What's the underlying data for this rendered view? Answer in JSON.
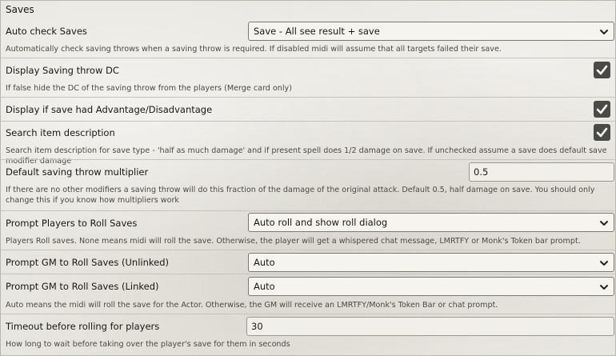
{
  "section": {
    "title": "Saves"
  },
  "settings": [
    {
      "label": "Auto check Saves",
      "control": "select",
      "value": "Save - All see result + save",
      "hint": "Automatically check saving throws when a saving throw is required. If disabled midi will assume that all targets failed their save."
    },
    {
      "label": "Display Saving throw DC",
      "control": "checkbox",
      "checked": true,
      "hint": "If false hide the DC of the saving throw from the players (Merge card only)"
    },
    {
      "label": "Display if save had Advantage/Disadvantage",
      "control": "checkbox",
      "checked": true,
      "hint": ""
    },
    {
      "label": "Search item description",
      "control": "checkbox",
      "checked": true,
      "hint": "Search item description for save type - 'half as much damage' and if present spell does 1/2 damage on save. If unchecked assume a save does default save modifier damage"
    },
    {
      "label": "Default saving throw multiplier",
      "control": "input",
      "value": "0.5",
      "hint": "If there are no other modifiers a saving throw will do this fraction of the damage of the original attack. Default 0.5, half damage on save. You should only change this if you know how multipliers work"
    },
    {
      "label": "Prompt Players to Roll Saves",
      "control": "select",
      "value": "Auto roll and show roll dialog",
      "hint": "Players Roll saves. None means midi will roll the save. Otherwise, the player will get a whispered chat message, LMRTFY or Monk's Token bar prompt."
    },
    {
      "label": "Prompt GM to Roll Saves (Unlinked)",
      "control": "select",
      "value": "Auto",
      "hint": ""
    },
    {
      "label": "Prompt GM to Roll Saves (Linked)",
      "control": "select",
      "value": "Auto",
      "hint": "Auto means the midi will roll the save for the Actor. Otherwise, the GM will receive an LMRTFY/Monk's Token Bar or chat prompt."
    },
    {
      "label": "Timeout before rolling for players",
      "control": "input",
      "value": "30",
      "hint": "How long to wait before taking over the player's save for them in seconds"
    }
  ],
  "icons": {
    "dropdown": "chevron-down-icon",
    "check": "check-icon"
  },
  "colors": {
    "checkbox_bg": "#4a4a47",
    "field_bg": "#f5f4ef"
  }
}
